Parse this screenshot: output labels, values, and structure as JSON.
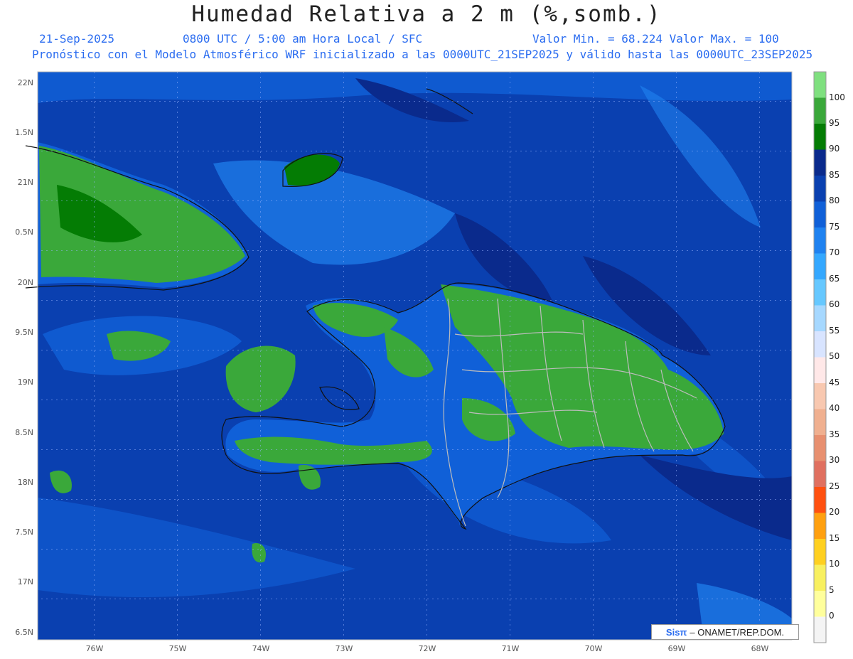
{
  "header": {
    "title": "Humedad Relativa a 2 m (%,somb.)",
    "date": "21-Sep-2025",
    "time": "0800 UTC / 5:00 am Hora Local / SFC",
    "min_max": "Valor Min. = 68.224  Valor Max. = 100",
    "forecast": "Pronóstico con el Modelo Atmosférico WRF inicializado a las 0000UTC_21SEP2025 y válido hasta las  0000UTC_23SEP2025"
  },
  "map": {
    "lat_labels": [
      "22N",
      "1.5N",
      "21N",
      "0.5N",
      "20N",
      "9.5N",
      "19N",
      "8.5N",
      "18N",
      "7.5N",
      "17N",
      "6.5N"
    ],
    "lon_labels": [
      "76W",
      "75W",
      "74W",
      "73W",
      "72W",
      "71W",
      "70W",
      "69W",
      "68W"
    ],
    "credit_brand": "Sisπ",
    "credit_text": "– ONAMET/REP.DOM."
  },
  "colorbar": {
    "labels": [
      "100",
      "95",
      "90",
      "85",
      "80",
      "75",
      "70",
      "65",
      "60",
      "55",
      "50",
      "45",
      "40",
      "35",
      "30",
      "25",
      "20",
      "15",
      "10",
      "5",
      "0"
    ],
    "colors": [
      "#7fe07f",
      "#3aa83a",
      "#047c04",
      "#0a2a8c",
      "#0a40b0",
      "#1060d8",
      "#1f82f0",
      "#34a8ff",
      "#66c8ff",
      "#a6d8ff",
      "#d8e4ff",
      "#ffe8e8",
      "#f8c8b0",
      "#f0b090",
      "#e89070",
      "#e07060",
      "#ff5010",
      "#ffa010",
      "#ffd020",
      "#f8f060",
      "#ffff9c",
      "#f4f4f4"
    ]
  }
}
